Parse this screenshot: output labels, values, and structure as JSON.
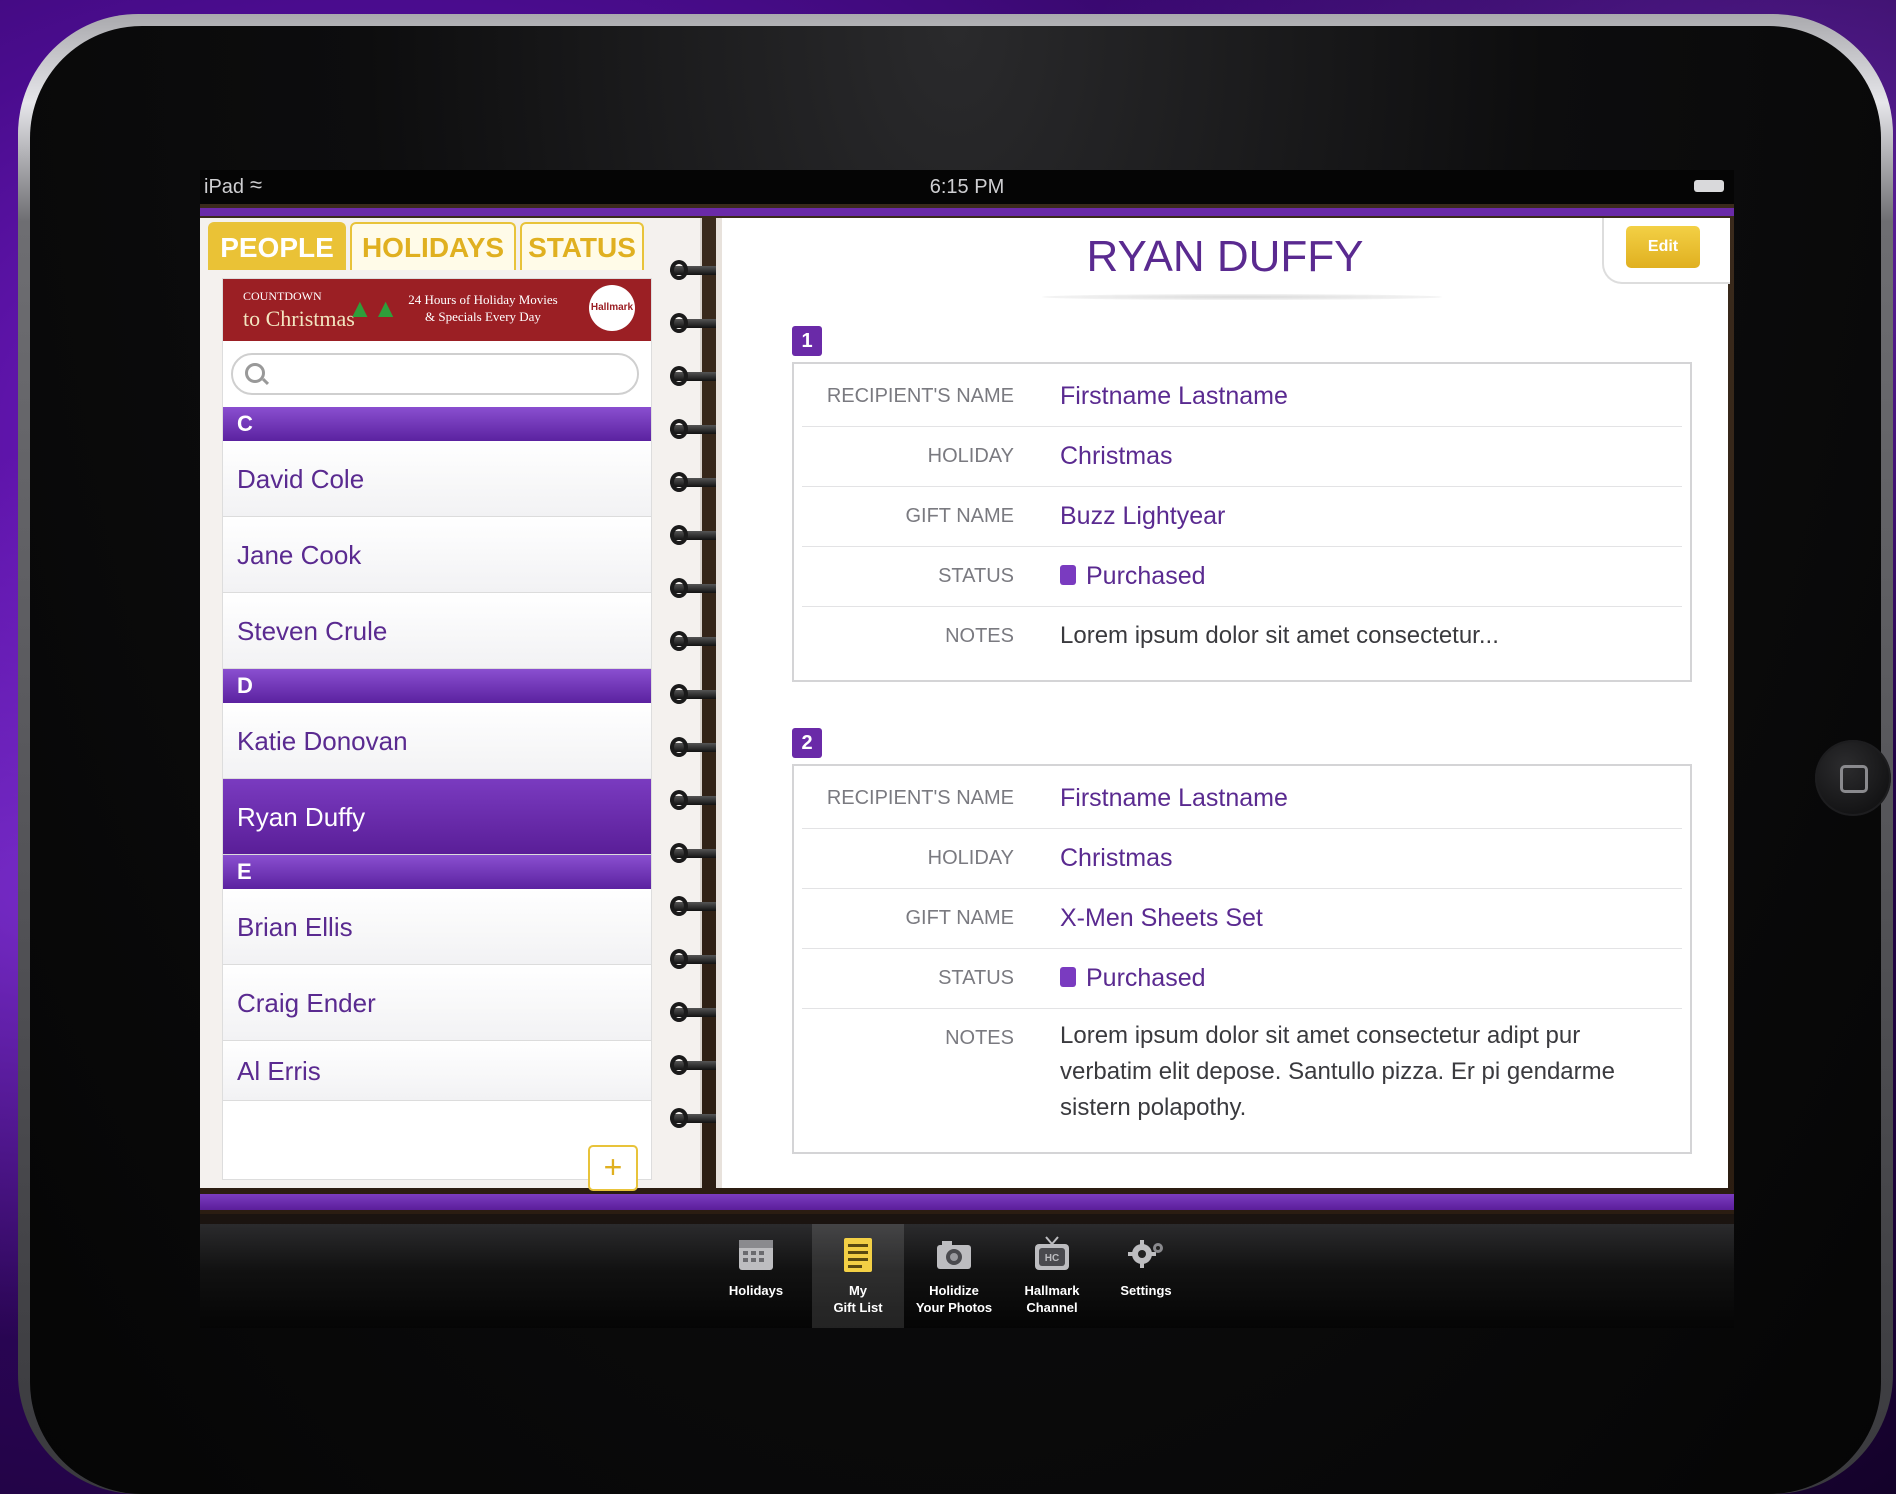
{
  "status_bar": {
    "carrier": "iPad",
    "time": "6:15 PM"
  },
  "tabs": [
    {
      "label": "PEOPLE",
      "active": true
    },
    {
      "label": "HOLIDAYS",
      "active": false
    },
    {
      "label": "STATUS",
      "active": false
    }
  ],
  "banner": {
    "brand_top": "COUNTDOWN",
    "brand_bottom": "to Christmas",
    "tagline_1": "24 Hours of Holiday Movies",
    "tagline_2": "& Specials Every Day",
    "ornament": "Hallmark"
  },
  "search": {
    "placeholder": ""
  },
  "sections": [
    {
      "letter": "C",
      "people": [
        "David Cole",
        "Jane Cook",
        "Steven Crule"
      ]
    },
    {
      "letter": "D",
      "people": [
        "Katie Donovan",
        "Ryan Duffy"
      ]
    },
    {
      "letter": "E",
      "people": [
        "Brian Ellis",
        "Craig Ender",
        "Al Erris"
      ]
    }
  ],
  "selected_person": "Ryan Duffy",
  "detail": {
    "title": "RYAN DUFFY",
    "edit_label": "Edit",
    "labels": {
      "recipient": "RECIPIENT'S NAME",
      "holiday": "HOLIDAY",
      "gift": "GIFT NAME",
      "status": "STATUS",
      "notes": "NOTES"
    },
    "gifts": [
      {
        "number": "1",
        "recipient": "Firstname Lastname",
        "holiday": "Christmas",
        "gift": "Buzz Lightyear",
        "status": "Purchased",
        "notes": "Lorem ipsum dolor sit amet consectetur..."
      },
      {
        "number": "2",
        "recipient": "Firstname Lastname",
        "holiday": "Christmas",
        "gift": "X-Men Sheets Set",
        "status": "Purchased",
        "notes": "Lorem ipsum dolor sit amet consectetur adipt pur verbatim elit depose. Santullo pizza. Er pi gendarme sistern polapothy."
      }
    ]
  },
  "tabbar": [
    {
      "label_1": "Holidays",
      "label_2": "",
      "icon": "calendar-icon",
      "active": false
    },
    {
      "label_1": "My",
      "label_2": "Gift List",
      "icon": "gift-list-icon",
      "active": true
    },
    {
      "label_1": "Holidize",
      "label_2": "Your Photos",
      "icon": "camera-icon",
      "active": false
    },
    {
      "label_1": "Hallmark",
      "label_2": "Channel",
      "icon": "tv-icon",
      "active": false
    },
    {
      "label_1": "Settings",
      "label_2": "",
      "icon": "gear-icon",
      "active": false
    }
  ],
  "colors": {
    "accent_purple": "#5a2a90",
    "accent_gold": "#e8c33a",
    "banner_red": "#9b1f24"
  }
}
